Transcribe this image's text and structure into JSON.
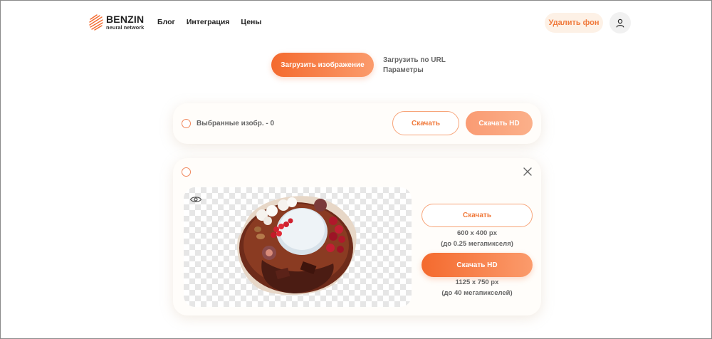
{
  "header": {
    "logo_name": "BENZIN",
    "logo_sub": "neural network",
    "nav": [
      "Блог",
      "Интеграция",
      "Цены"
    ],
    "remove_bg_label": "Удалить фон"
  },
  "upload": {
    "button_label": "Загрузить изображение",
    "url_label": "Загрузить по URL",
    "params_label": "Параметры"
  },
  "selection": {
    "selected_label": "Выбранные изобр. - 0",
    "download_label": "Скачать",
    "download_hd_label": "Скачать HD"
  },
  "result": {
    "download_label": "Скачать",
    "download_size": "600 x 400 px",
    "download_mp": "(до 0.25 мегапикселя)",
    "download_hd_label": "Скачать HD",
    "hd_size": "1125 x 750 px",
    "hd_mp": "(до 40 мегапикселей)"
  },
  "colors": {
    "accent": "#f46a2e",
    "accent_light": "#fb9b6c",
    "accent_soft_bg": "#fdf1e6"
  },
  "icons": [
    "logo-icon",
    "user-icon",
    "close-icon",
    "eye-icon"
  ]
}
